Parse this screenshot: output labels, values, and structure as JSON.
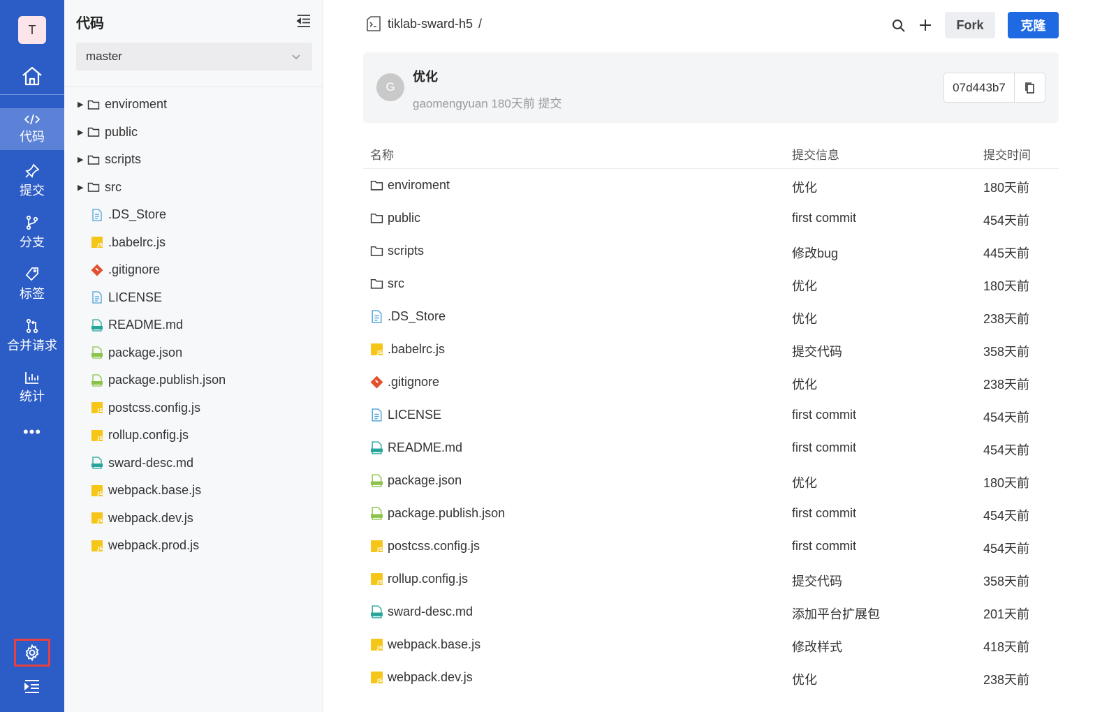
{
  "nav": {
    "avatar_letter": "T",
    "items": [
      {
        "label": "代码",
        "icon": "code-icon",
        "active": true
      },
      {
        "label": "提交",
        "icon": "pin-icon",
        "active": false
      },
      {
        "label": "分支",
        "icon": "branch-icon",
        "active": false
      },
      {
        "label": "标签",
        "icon": "tag-icon",
        "active": false
      },
      {
        "label": "合并请求",
        "icon": "merge-request-icon",
        "active": false
      },
      {
        "label": "统计",
        "icon": "chart-icon",
        "active": false
      }
    ],
    "more": "•••"
  },
  "tree": {
    "title": "代码",
    "branch": "master",
    "items": [
      {
        "name": "enviroment",
        "type": "folder"
      },
      {
        "name": "public",
        "type": "folder"
      },
      {
        "name": "scripts",
        "type": "folder"
      },
      {
        "name": "src",
        "type": "folder"
      },
      {
        "name": ".DS_Store",
        "type": "text"
      },
      {
        "name": ".babelrc.js",
        "type": "js"
      },
      {
        "name": ".gitignore",
        "type": "git"
      },
      {
        "name": "LICENSE",
        "type": "text"
      },
      {
        "name": "README.md",
        "type": "md"
      },
      {
        "name": "package.json",
        "type": "json"
      },
      {
        "name": "package.publish.json",
        "type": "json"
      },
      {
        "name": "postcss.config.js",
        "type": "js"
      },
      {
        "name": "rollup.config.js",
        "type": "js"
      },
      {
        "name": "sward-desc.md",
        "type": "md"
      },
      {
        "name": "webpack.base.js",
        "type": "js"
      },
      {
        "name": "webpack.dev.js",
        "type": "js"
      },
      {
        "name": "webpack.prod.js",
        "type": "js"
      }
    ]
  },
  "header": {
    "repo": "tiklab-sward-h5",
    "sep": "/",
    "fork_label": "Fork",
    "clone_label": "克隆"
  },
  "commit": {
    "avatar_letter": "G",
    "message": "优化",
    "meta": "gaomengyuan 180天前 提交",
    "sha": "07d443b7"
  },
  "table": {
    "headers": {
      "name": "名称",
      "message": "提交信息",
      "time": "提交时间"
    },
    "rows": [
      {
        "name": "enviroment",
        "type": "folder",
        "message": "优化",
        "time": "180天前"
      },
      {
        "name": "public",
        "type": "folder",
        "message": "first commit",
        "time": "454天前"
      },
      {
        "name": "scripts",
        "type": "folder",
        "message": "修改bug",
        "time": "445天前"
      },
      {
        "name": "src",
        "type": "folder",
        "message": "优化",
        "time": "180天前"
      },
      {
        "name": ".DS_Store",
        "type": "text",
        "message": "优化",
        "time": "238天前"
      },
      {
        "name": ".babelrc.js",
        "type": "js",
        "message": "提交代码",
        "time": "358天前"
      },
      {
        "name": ".gitignore",
        "type": "git",
        "message": "优化",
        "time": "238天前"
      },
      {
        "name": "LICENSE",
        "type": "text",
        "message": "first commit",
        "time": "454天前"
      },
      {
        "name": "README.md",
        "type": "md",
        "message": "first commit",
        "time": "454天前"
      },
      {
        "name": "package.json",
        "type": "json",
        "message": "优化",
        "time": "180天前"
      },
      {
        "name": "package.publish.json",
        "type": "json",
        "message": "first commit",
        "time": "454天前"
      },
      {
        "name": "postcss.config.js",
        "type": "js",
        "message": "first commit",
        "time": "454天前"
      },
      {
        "name": "rollup.config.js",
        "type": "js",
        "message": "提交代码",
        "time": "358天前"
      },
      {
        "name": "sward-desc.md",
        "type": "md",
        "message": "添加平台扩展包",
        "time": "201天前"
      },
      {
        "name": "webpack.base.js",
        "type": "js",
        "message": "修改样式",
        "time": "418天前"
      },
      {
        "name": "webpack.dev.js",
        "type": "js",
        "message": "优化",
        "time": "238天前"
      }
    ]
  },
  "colors": {
    "nav_bg": "#2c5cc5",
    "nav_active": "#5b82d6",
    "primary": "#1f6ae3",
    "settings_highlight": "#e84040",
    "js_icon": "#f5c518",
    "json_icon": "#8bc34a",
    "md_icon": "#26a69a",
    "git_icon": "#e2502e",
    "text_icon": "#4a9fd8"
  }
}
